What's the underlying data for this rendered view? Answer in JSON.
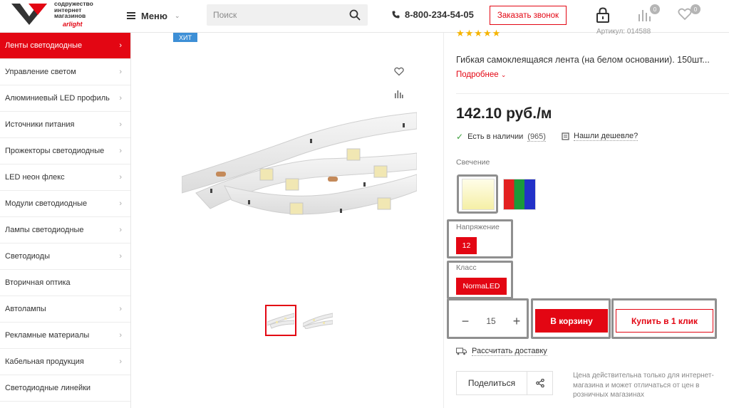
{
  "header": {
    "logo_lines": [
      "содружество",
      "интернет",
      "магазинов"
    ],
    "logo_brand": "arlight",
    "menu_label": "Меню",
    "search_placeholder": "Поиск",
    "phone": "8-800-234-54-05",
    "callback_label": "Заказать звонок",
    "compare_count": "0",
    "favorites_count": "0"
  },
  "sidebar": {
    "items": [
      {
        "label": "Ленты светодиодные",
        "active": true
      },
      {
        "label": "Управление светом"
      },
      {
        "label": "Алюминиевый LED профиль"
      },
      {
        "label": "Источники питания"
      },
      {
        "label": "Прожекторы светодиодные"
      },
      {
        "label": "LED неон флекс"
      },
      {
        "label": "Модули светодиодные"
      },
      {
        "label": "Лампы светодиодные"
      },
      {
        "label": "Светодиоды"
      },
      {
        "label": "Вторичная оптика"
      },
      {
        "label": "Автолампы"
      },
      {
        "label": "Рекламные материалы"
      },
      {
        "label": "Кабельная продукция"
      },
      {
        "label": "Светодиодные линейки"
      }
    ]
  },
  "product": {
    "badge": "ХИТ",
    "stars": "★★★★★",
    "sku": "Артикул: 014588",
    "description": "Гибкая самоклеящаяся лента (на белом основании). 150шт...",
    "more_label": "Подробнее",
    "price": "142.10 руб./м",
    "stock_label": "Есть в наличии",
    "stock_count": "(965)",
    "cheaper_label": "Нашли дешевле?",
    "glow_label": "Свечение",
    "voltage_label": "Напряжение",
    "voltage_value": "12",
    "class_label": "Класс",
    "class_value": "NormaLED",
    "quantity": "15",
    "cart_label": "В корзину",
    "one_click_label": "Купить в 1 клик",
    "delivery_label": "Рассчитать доставку",
    "share_label": "Поделиться",
    "price_note": "Цена действительна только для интернет-магазина и может отличаться от цен в розничных магазинах"
  },
  "colors": {
    "accent": "#e30613",
    "badge_blue": "#3d8fd6",
    "star": "#f6b400",
    "highlight_border": "#8f8f8f"
  }
}
